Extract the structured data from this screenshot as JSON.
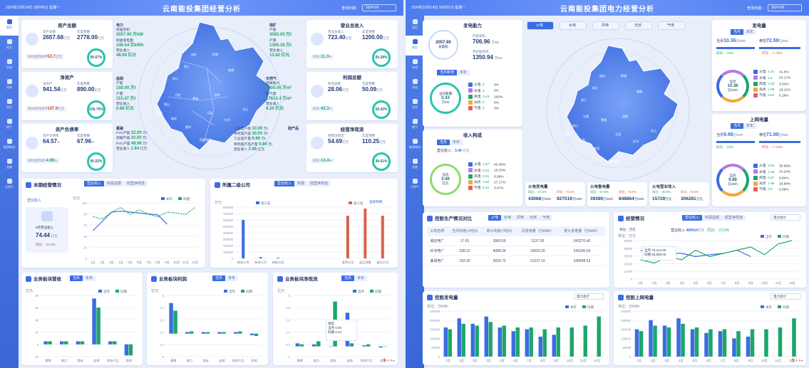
{
  "left": {
    "topbar": {
      "date": "2024年10月14日  10时45分  星期一",
      "title": "云南能投集团经营分析",
      "date_label": "查询日期：",
      "date_value": "2024-09"
    },
    "side": [
      "首页",
      "电力",
      "水电",
      "风电",
      "光伏",
      "燃气",
      "能源物流",
      "金融",
      "天然气"
    ],
    "asset_total": {
      "title": "资产总额",
      "now_label": "资产总额",
      "now": "2657.68",
      "now_unit": "亿元",
      "plan_label": "年度预算",
      "plan": "2778.00",
      "plan_unit": "亿元",
      "yoy_label": "同比/较年初",
      "yoy": "+52.7",
      "yoy_unit": "亿元",
      "pct": "95.67%"
    },
    "net_asset": {
      "title": "净资产",
      "now_label": "净资产",
      "now": "941.54",
      "now_unit": "亿元",
      "plan_label": "年度预算",
      "plan": "890.00",
      "plan_unit": "亿元",
      "yoy_label": "同比/较年初",
      "yoy": "+147.9",
      "yoy_unit": "亿元",
      "pct": "105.79%"
    },
    "debt": {
      "title": "资产负债率",
      "now_label": "资产负债率",
      "now": "64.57",
      "now_unit": "%",
      "plan_label": "年度预算",
      "plan": "67.96",
      "plan_unit": "%",
      "yoy_label": "同比/较年初",
      "yoy": "-4.96",
      "yoy_unit": "%",
      "pct": "95.02%"
    },
    "revenue": {
      "title": "营业总收入",
      "now_label": "营业总收入",
      "now": "723.40",
      "now_unit": "亿元",
      "plan_label": "年度预算",
      "plan": "1200.00",
      "plan_unit": "亿元",
      "yoy_label": "同比",
      "yoy": "-11.3",
      "yoy_unit": "%",
      "pct": "60.28%"
    },
    "profit": {
      "title": "利润总额",
      "now_label": "利润总额",
      "now": "28.06",
      "now_unit": "亿元",
      "plan_label": "年度预算",
      "plan": "50.09",
      "plan_unit": "亿元",
      "yoy_label": "同比",
      "yoy": "-42.3",
      "yoy_unit": "%",
      "pct": "56.02%"
    },
    "cash": {
      "title": "经营净现流",
      "now_label": "经营净现流",
      "now": "54.69",
      "now_unit": "亿元",
      "plan_label": "年度预算",
      "plan": "110.25",
      "plan_unit": "亿元",
      "yoy_label": "同比",
      "yoy": "-13.4",
      "yoy_unit": "%",
      "pct": "49.61%"
    },
    "map_blocks": {
      "power": {
        "title": "电力",
        "rows": [
          [
            "权益装机",
            ""
          ],
          [
            "2057.90",
            "万kW"
          ],
          [
            "权益发电量",
            ""
          ],
          [
            "146.54",
            "亿kWh"
          ],
          [
            "营业收入",
            ""
          ],
          [
            "48.94",
            "亿元"
          ]
        ]
      },
      "coal": {
        "title": "煤矿",
        "rows": [
          [
            "产能",
            ""
          ],
          [
            "3093.00",
            "万t"
          ],
          [
            "产量",
            ""
          ],
          [
            "1305.36",
            "万t"
          ],
          [
            "营业收入",
            ""
          ],
          [
            "13.62",
            "亿元"
          ]
        ]
      },
      "salt": {
        "title": "盐硝",
        "rows": [
          [
            "产能",
            ""
          ],
          [
            "180.00",
            "万t"
          ],
          [
            "产量",
            ""
          ],
          [
            "115.47",
            "万t"
          ],
          [
            "营业收入",
            ""
          ],
          [
            "0.88",
            "亿元"
          ]
        ]
      },
      "gas": {
        "title": "天然气",
        "rows": [
          [
            "管输能力",
            ""
          ],
          [
            "3600.00",
            "万m³"
          ],
          [
            "售气量",
            ""
          ],
          [
            "27812.4",
            "万m³"
          ],
          [
            "营业收入",
            ""
          ],
          [
            "9.20",
            "亿元"
          ]
        ]
      },
      "chlor": {
        "title": "氯碱",
        "rows": [
          [
            "PVC产能",
            "22.00",
            "万t"
          ],
          [
            "烧碱产能",
            "20.00",
            "万t"
          ],
          [
            "PVC产量",
            "48.98",
            "万t"
          ],
          [
            "营业收入",
            "1.64",
            "亿元"
          ]
        ]
      },
      "ops": {
        "title": "",
        "rows": [
          [
            "工业硅产能",
            "10.00",
            "万t"
          ],
          [
            "有机硅产能",
            "30.00",
            "万t"
          ],
          [
            "工业硅产量",
            "6.68",
            "万t"
          ],
          [
            "有机硅产品产量",
            "9.84",
            "万t"
          ],
          [
            "营业收入",
            "2.96",
            "亿元"
          ]
        ]
      },
      "misc": {
        "title": "硅产品"
      }
    },
    "cities": [
      "昭通",
      "曲靖",
      "丽江",
      "大理",
      "楚雄",
      "昆明",
      "玉溪",
      "红河",
      "文山",
      "普洱",
      "西双版纳",
      "临沧",
      "保山",
      "德宏",
      "怒江",
      "迪庆"
    ],
    "period": {
      "title": "本期经营情况",
      "tabs": [
        "营业收入",
        "利润总额",
        "经营净现流"
      ],
      "item": "营业收入",
      "card_label": "9月营业收入",
      "card_value": "74.44",
      "card_unit": "亿元",
      "card_yoy": "同比：-34.8%"
    },
    "subsidiary": {
      "title": "所属二级公司",
      "tabs": [
        "营业收入",
        "利润",
        "经营净现流"
      ],
      "ylabel": "万元",
      "ylabel2": "万元",
      "legend1": "第三名",
      "legend2": "后三名",
      "link": "查看明细"
    },
    "seg_rev": {
      "title": "业务板块营收",
      "tabs": [
        "当月",
        "本年"
      ],
      "extra": [
        "营收",
        "结构"
      ],
      "ylabel": "亿元",
      "legend": [
        "当月",
        "同期"
      ]
    },
    "seg_profit": {
      "title": "业务板块利润",
      "tabs": [
        "当月",
        "本年"
      ],
      "ylabel": "亿元",
      "legend": [
        "当月",
        "同期"
      ]
    },
    "seg_cash": {
      "title": "业务板块净现流",
      "tabs": [
        "当月",
        "本年"
      ],
      "ylabel": "亿元",
      "legend": [
        "当月",
        "同期"
      ],
      "tip": {
        "t": "煤炭",
        "a": "当月",
        "av": "0.00",
        "b": "同期",
        "bv": "4.43"
      }
    }
  },
  "right": {
    "topbar": {
      "date": "2024年10月14日  10时51分  星期一",
      "title": "云南能投集团电力经营分析",
      "date_label": "查询日期：",
      "date_value": "2024-09"
    },
    "side": [
      "首页",
      "电力",
      "水电",
      "风电",
      "光伏",
      "燃气",
      "能源物流",
      "金融",
      "天然气"
    ],
    "capacity": {
      "title": "发电能力",
      "total": "2057.90",
      "total_unit": "万kW",
      "total_label": "总装机",
      "ctl_label": "控股装机",
      "ctl": "706.96",
      "ctl_unit": "万kW",
      "eq_label": "参控股装机",
      "eq": "1350.94",
      "eq_unit": "万kW",
      "tabs": [
        "当月新增",
        "本年"
      ],
      "ring_label": "当月新增",
      "ring_value": "0.43",
      "ring_unit": "万kW",
      "items": [
        [
          "火电",
          "0",
          "0%"
        ],
        [
          "水电",
          "0",
          "0%"
        ],
        [
          "风电",
          "0.43",
          "100%"
        ],
        [
          "光伏",
          "0",
          "0%"
        ],
        [
          "气电",
          "0",
          "0%"
        ]
      ]
    },
    "mix": {
      "title": "收入构成",
      "tabs": [
        "当月",
        "本年"
      ],
      "label": "营业收入：",
      "value": "3.46",
      "unit": "亿元",
      "ring_label": "当月",
      "ring_value": "3.46",
      "ring_unit": "亿元",
      "items": [
        [
          "火电",
          "1.57",
          "45.38%"
        ],
        [
          "水电",
          "0.52",
          "15.03%"
        ],
        [
          "风电",
          "0.31",
          "8.96%"
        ],
        [
          "光伏",
          "0.94",
          "27.17%"
        ],
        [
          "气电",
          "0.12",
          "3.47%"
        ]
      ]
    },
    "types": [
      "火电",
      "水电",
      "风电",
      "光伏",
      "气电"
    ],
    "fire_gen": {
      "title": "火电发电量",
      "yoy": "同比：-37.3%",
      "mom": "环比：+0.4%",
      "v1": "43068",
      "u1": "万kWh",
      "v2": "927519",
      "u2": "万kWh"
    },
    "fire_use": {
      "title": "火电售电量",
      "yoy": "同比：-37.5%",
      "mom": "环比：+0.9%",
      "v1": "39390",
      "u1": "万kWh",
      "v2": "848864",
      "u2": "万kWh"
    },
    "fire_rev": {
      "title": "火电营业收入",
      "yoy": "同比：-30.9%",
      "mom": "环比：+8.6%",
      "v1": "15729",
      "u1": "万元",
      "v2": "306281",
      "u2": "万元"
    },
    "gen": {
      "title": "发电量",
      "tabs": [
        "当月",
        "本年"
      ],
      "now_label": "当月",
      "now": "10.36",
      "now_unit": "亿kWh",
      "ref_label": "参控",
      "ref": "72.59",
      "ref_unit": "亿kWh",
      "yoy": "同比：-23%",
      "mom": "环比：+7.75%",
      "ring_label": "当月",
      "ring_value": "10.36",
      "ring_unit": "亿kWh",
      "items": [
        [
          "火电",
          "4.31",
          "41.6%"
        ],
        [
          "水电",
          "2.4",
          "23.17%"
        ],
        [
          "风电",
          "1.03",
          "9.94%"
        ],
        [
          "光伏",
          "1.98",
          "19.11%"
        ],
        [
          "气电",
          "0.64",
          "6.18%"
        ]
      ]
    },
    "grid": {
      "title": "上网电量",
      "tabs": [
        "当月",
        "本年"
      ],
      "now_label": "当月",
      "now": "9.86",
      "now_unit": "亿kWh",
      "ref_label": "参控",
      "ref": "71.80",
      "ref_unit": "亿kWh",
      "yoy": "同比：-23%",
      "mom": "环比：+7.34%",
      "ring_label": "当月",
      "ring_value": "9.86",
      "ring_unit": "亿kWh",
      "items": [
        [
          "火电",
          "3.94",
          "39.96%"
        ],
        [
          "水电",
          "2.39",
          "24.24%"
        ],
        [
          "风电",
          "0.97",
          "9.84%"
        ],
        [
          "光伏",
          "1.96",
          "19.88%"
        ],
        [
          "气电",
          "0.6",
          "6.09%"
        ]
      ]
    },
    "prod": {
      "title": "控股生产情况对比",
      "tabs": [
        "火电",
        "水电",
        "风电",
        "光伏",
        "气电"
      ],
      "head": [
        "公司名称",
        "当月利用小时(h)",
        "累计利用小时(h)",
        "月发电量（万kWh）",
        "累计发电量（万kWh）"
      ],
      "rows": [
        [
          "威信电厂",
          "17.81",
          "2860.59",
          "2137.30",
          "343270.40"
        ],
        [
          "红河电厂",
          "328.22",
          "4088.34",
          "19693.20",
          "245300.04"
        ],
        [
          "曲靖电厂",
          "183.26",
          "2839.72",
          "21237.10",
          "338948.63"
        ]
      ]
    },
    "ops": {
      "title": "经营情况",
      "tabs": [
        "营业收入",
        "利润总额",
        "经营净现流"
      ],
      "select": "电力合计",
      "ylabel": "单位：万元",
      "label": "营业收入",
      "value": "489414",
      "unit": "万元",
      "yoy": "同比：-21.5%",
      "tip_a": "当月",
      "tip_av": "75,414.00",
      "tip_b": "同期",
      "tip_bv": "56,566.00"
    },
    "ctl_gen": {
      "title": "控股发电量",
      "select": "电力合计",
      "ylabel": "单位：万kWh",
      "legend": [
        "本年",
        "同期"
      ]
    },
    "ctl_grid": {
      "title": "控股上网电量",
      "select": "电力合计",
      "ylabel": "单位：万kWh",
      "legend": [
        "本年",
        "同期"
      ]
    }
  },
  "months": [
    "1月",
    "2月",
    "3月",
    "4月",
    "5月",
    "6月",
    "7月",
    "8月",
    "9月",
    "10月",
    "11月",
    "12月"
  ],
  "chart_data": [
    {
      "type": "line",
      "title": "营业收入",
      "ylabel": "亿元",
      "categories": [
        "1月",
        "2月",
        "3月",
        "4月",
        "5月",
        "6月",
        "7月",
        "8月",
        "9月",
        "10月",
        "11月",
        "12月"
      ],
      "series": [
        {
          "name": "本年",
          "values": [
            60,
            80,
            100,
            102,
            100,
            98,
            96,
            94,
            74
          ]
        },
        {
          "name": "同期",
          "values": [
            90,
            85,
            100,
            110,
            95,
            105,
            95,
            90,
            100,
            98,
            95,
            110
          ]
        }
      ],
      "ylim": [
        0,
        120
      ]
    },
    {
      "type": "bar",
      "title": "所属二级公司",
      "ylabel": "万元",
      "categories": [
        "物流公司",
        "新材公司",
        "新能公司",
        "",
        "",
        "",
        "清荷公司",
        "盐正源集",
        "清达公司"
      ],
      "values": [
        600000,
        20000,
        10000,
        0,
        0,
        0,
        0,
        0,
        0
      ],
      "series": [
        {
          "name": "第三名",
          "values": [
            600000,
            20000,
            10000
          ]
        },
        {
          "name": "后三名",
          "values": [
            -500,
            -800,
            -900
          ]
        }
      ],
      "ylim": [
        0,
        800000
      ]
    },
    {
      "type": "bar",
      "title": "业务板块营收",
      "ylabel": "亿元",
      "categories": [
        "基建",
        "电力",
        "煤炭",
        "盐硝",
        "其他产品",
        "其他"
      ],
      "series": [
        {
          "name": "当月",
          "values": [
            5,
            5,
            5,
            75,
            5,
            -18
          ]
        },
        {
          "name": "同期",
          "values": [
            5,
            5,
            5,
            60,
            5,
            -18
          ]
        }
      ],
      "ylim": [
        -20,
        80
      ]
    },
    {
      "type": "bar",
      "title": "业务板块利润",
      "ylabel": "亿元",
      "categories": [
        "基建",
        "电力",
        "煤炭",
        "盐硝",
        "其他产品",
        "其他"
      ],
      "series": [
        {
          "name": "当月",
          "values": [
            4,
            0.2,
            0.2,
            0.2,
            0.2,
            -0.2
          ]
        },
        {
          "name": "同期",
          "values": [
            3,
            0.3,
            0.2,
            0.2,
            0.3,
            -0.3
          ]
        }
      ],
      "ylim": [
        -3,
        5
      ]
    },
    {
      "type": "bar",
      "title": "业务板块净现流",
      "ylabel": "亿元",
      "categories": [
        "基建",
        "电力",
        "煤炭",
        "盐硝",
        "其他产品",
        "其他"
      ],
      "series": [
        {
          "name": "当月",
          "values": [
            0.3,
            0.2,
            0,
            3.3,
            0.1,
            -0.1
          ]
        },
        {
          "name": "同期",
          "values": [
            0.2,
            0.5,
            4.4,
            0.3,
            0.2,
            0
          ]
        }
      ],
      "ylim": [
        -1,
        5
      ]
    },
    {
      "type": "line",
      "title": "经营情况",
      "ylabel": "单位：万元",
      "categories": [
        "1月",
        "2月",
        "3月",
        "4月",
        "5月",
        "6月",
        "7月",
        "8月",
        "9月",
        "10月",
        "11月",
        "12月"
      ],
      "series": [
        {
          "name": "当月",
          "values": [
            45000,
            35000,
            40000,
            40000,
            35000,
            38000,
            40000,
            45000,
            35000
          ]
        },
        {
          "name": "同期",
          "values": [
            30000,
            25000,
            35000,
            30000,
            45000,
            35000,
            40000,
            45000,
            50000,
            38000,
            55000,
            60000
          ]
        }
      ],
      "ylim": [
        0,
        60000
      ]
    },
    {
      "type": "bar",
      "title": "控股发电量",
      "ylabel": "单位：万kWh",
      "categories": [
        "1月",
        "2月",
        "3月",
        "4月",
        "5月",
        "6月",
        "7月",
        "8月",
        "9月",
        "10月",
        "11月",
        "12月"
      ],
      "series": [
        {
          "name": "本年",
          "values": [
            160000,
            210000,
            180000,
            220000,
            160000,
            140000,
            150000,
            110000,
            120000
          ]
        },
        {
          "name": "同期",
          "values": [
            150000,
            180000,
            170000,
            190000,
            170000,
            160000,
            160000,
            150000,
            160000,
            160000,
            170000,
            220000
          ]
        }
      ],
      "ylim": [
        0,
        250000
      ]
    },
    {
      "type": "bar",
      "title": "控股上网电量",
      "ylabel": "单位：万kWh",
      "categories": [
        "1月",
        "2月",
        "3月",
        "4月",
        "5月",
        "6月",
        "7月",
        "8月",
        "9月",
        "10月",
        "11月",
        "12月"
      ],
      "series": [
        {
          "name": "本年",
          "values": [
            150000,
            200000,
            170000,
            210000,
            150000,
            130000,
            140000,
            100000,
            110000
          ]
        },
        {
          "name": "同期",
          "values": [
            140000,
            170000,
            160000,
            180000,
            160000,
            150000,
            150000,
            140000,
            150000,
            150000,
            160000,
            210000
          ]
        }
      ],
      "ylim": [
        0,
        250000
      ]
    }
  ]
}
